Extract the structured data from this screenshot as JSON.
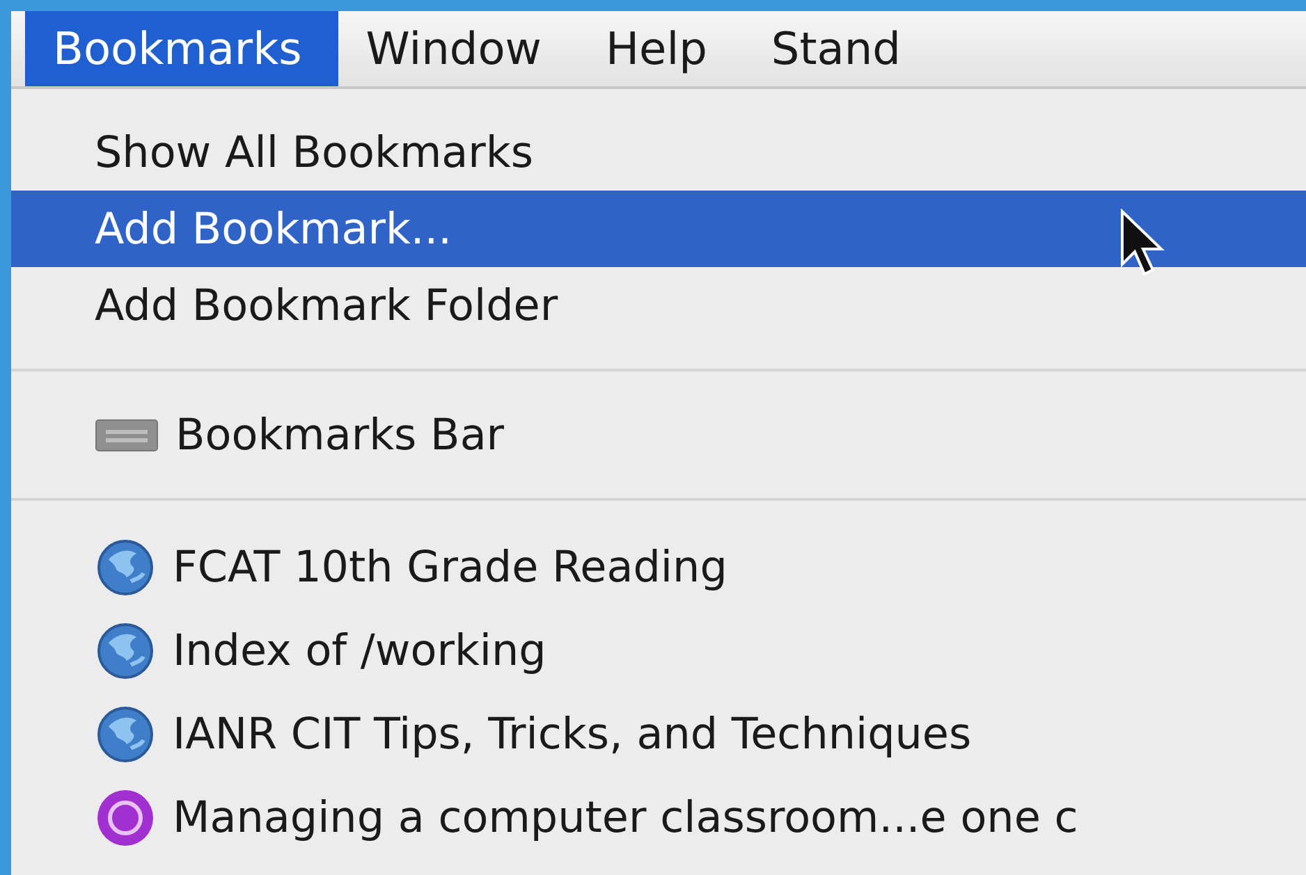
{
  "menubar": [
    {
      "label": "Bookmarks",
      "selected": true
    },
    {
      "label": "Window",
      "selected": false
    },
    {
      "label": "Help",
      "selected": false
    },
    {
      "label": "Stand",
      "selected": false
    }
  ],
  "menu": [
    {
      "kind": "command",
      "label": "Show All Bookmarks",
      "selected": false
    },
    {
      "kind": "command",
      "label": "Add Bookmark...",
      "selected": true
    },
    {
      "kind": "command",
      "label": "Add Bookmark Folder",
      "selected": false
    },
    {
      "kind": "separator"
    },
    {
      "kind": "folder",
      "label": "Bookmarks Bar",
      "selected": false
    },
    {
      "kind": "separator"
    },
    {
      "kind": "bookmark",
      "label": "FCAT 10th Grade Reading",
      "selected": false
    },
    {
      "kind": "bookmark",
      "label": "Index of /working",
      "selected": false
    },
    {
      "kind": "bookmark",
      "label": "IANR CIT Tips, Tricks, and Techniques",
      "selected": false
    },
    {
      "kind": "badged",
      "label": "Managing a computer classroom...e one c",
      "selected": false
    }
  ]
}
